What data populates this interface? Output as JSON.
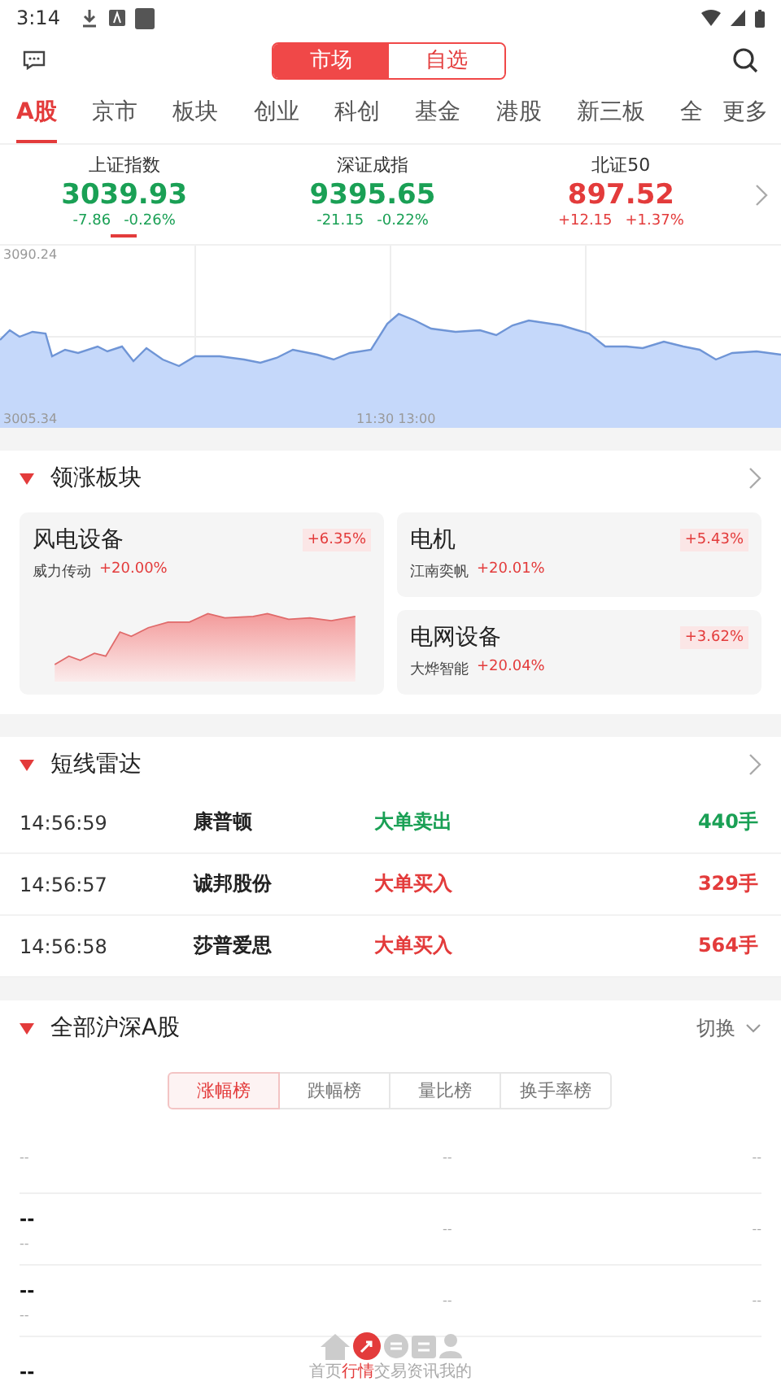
{
  "status_bar": {
    "time": "3:14"
  },
  "top_bar": {
    "segments": [
      {
        "label": "市场",
        "selected": true
      },
      {
        "label": "自选",
        "selected": false
      }
    ]
  },
  "tabs": [
    {
      "label": "A股",
      "selected": true
    },
    {
      "label": "京市",
      "selected": false
    },
    {
      "label": "板块",
      "selected": false
    },
    {
      "label": "创业",
      "selected": false
    },
    {
      "label": "科创",
      "selected": false
    },
    {
      "label": "基金",
      "selected": false
    },
    {
      "label": "港股",
      "selected": false
    },
    {
      "label": "新三板",
      "selected": false
    },
    {
      "label": "全",
      "selected": false
    }
  ],
  "more_label": "更多",
  "indices": [
    {
      "name": "上证指数",
      "value": "3039.93",
      "change": "-7.86",
      "percent": "-0.26%",
      "color": "#1aa055",
      "selected": true
    },
    {
      "name": "深证成指",
      "value": "9395.65",
      "change": "-21.15",
      "percent": "-0.22%",
      "color": "#1aa055",
      "selected": false
    },
    {
      "name": "北证50",
      "value": "897.52",
      "change": "+12.15",
      "percent": "+1.37%",
      "color": "#e33b3b",
      "selected": false
    }
  ],
  "intraday_chart": {
    "top_label": "3090.24",
    "bottom_label": "3005.34",
    "time_label": "11:30 13:00"
  },
  "leading_sectors": {
    "title": "领涨板块",
    "cards": [
      {
        "name": "风电设备",
        "percent": "+6.35%",
        "leader": "威力传动",
        "leader_percent": "+20.00%",
        "kind": "large"
      },
      {
        "name": "电机",
        "percent": "+5.43%",
        "leader": "江南奕帆",
        "leader_percent": "+20.01%",
        "kind": "small"
      },
      {
        "name": "电网设备",
        "percent": "+3.62%",
        "leader": "大烨智能",
        "leader_percent": "+20.04%",
        "kind": "small"
      }
    ]
  },
  "radar": {
    "title": "短线雷达",
    "rows": [
      {
        "time": "14:56:59",
        "stock": "康普顿",
        "action": "大单卖出",
        "volume": "440手",
        "color": "#1aa055"
      },
      {
        "time": "14:56:57",
        "stock": "诚邦股份",
        "action": "大单买入",
        "volume": "329手",
        "color": "#e33b3b"
      },
      {
        "time": "14:56:58",
        "stock": "莎普爱思",
        "action": "大单买入",
        "volume": "564手",
        "color": "#e33b3b"
      }
    ]
  },
  "all_a_shares": {
    "title": "全部沪深A股",
    "switch_label": "切换",
    "tabs": [
      {
        "label": "涨幅榜",
        "selected": true
      },
      {
        "label": "跌幅榜",
        "selected": false
      },
      {
        "label": "量比榜",
        "selected": false
      },
      {
        "label": "换手率榜",
        "selected": false
      }
    ],
    "rows": [
      {
        "code": "--",
        "column_2": "--",
        "column_3": "--"
      },
      {
        "name": "--",
        "code": "--",
        "column_2": "--",
        "column_3": "--"
      },
      {
        "name": "--",
        "code": "--",
        "column_2": "--",
        "column_3": "--"
      },
      {
        "name": "--"
      }
    ]
  },
  "bottom_nav": [
    {
      "label": "首页",
      "selected": false
    },
    {
      "label": "行情",
      "selected": true
    },
    {
      "label": "交易",
      "selected": false
    },
    {
      "label": "资讯",
      "selected": false
    },
    {
      "label": "我的",
      "selected": false
    }
  ]
}
